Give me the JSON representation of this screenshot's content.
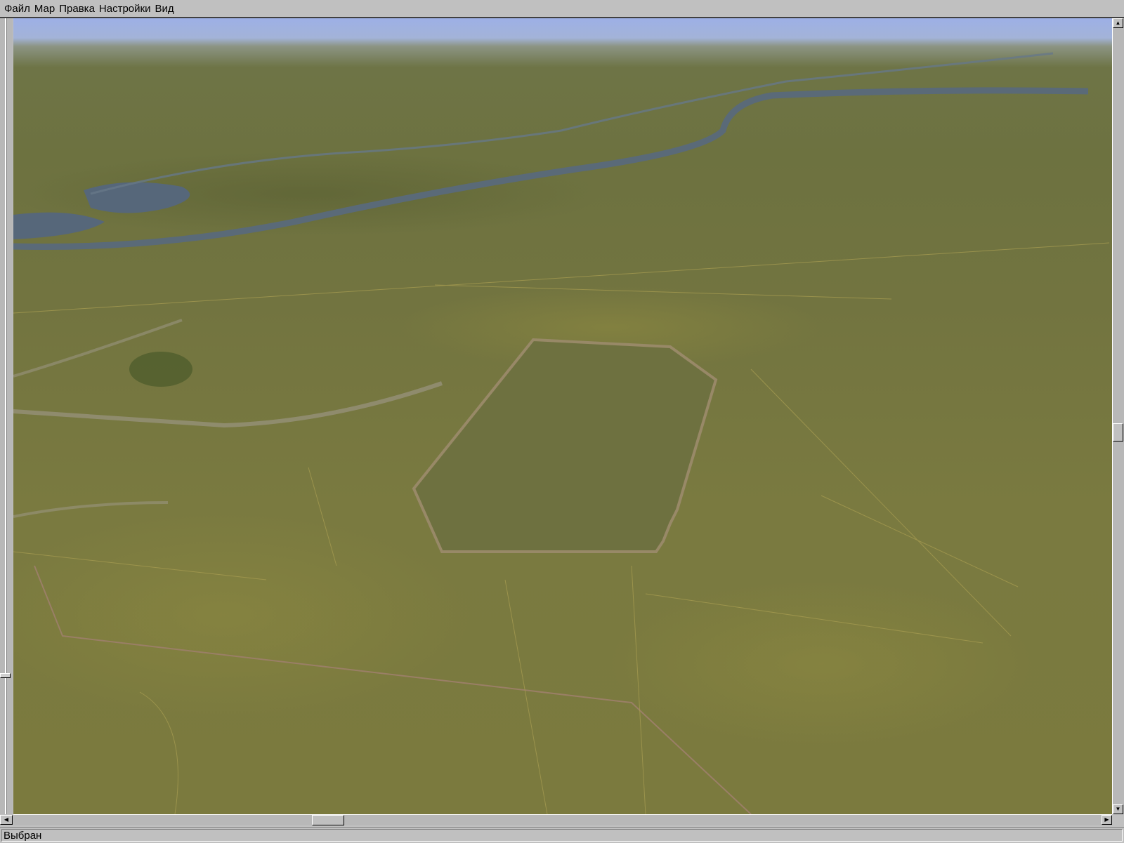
{
  "menubar": {
    "items": [
      {
        "label": "Файл"
      },
      {
        "label": "Мар"
      },
      {
        "label": "Правка"
      },
      {
        "label": "Настройки"
      },
      {
        "label": "Вид"
      }
    ]
  },
  "view": {
    "description_icon": "terrain-3d-view"
  },
  "scrollbars": {
    "vertical_position": 0.5,
    "horizontal_position": 0.28
  },
  "status": {
    "text": "Выбран"
  },
  "colors": {
    "sky": "#9db0e6",
    "terrain": "#737440",
    "river": "#5a6a78",
    "road": "#9a8a6a"
  }
}
